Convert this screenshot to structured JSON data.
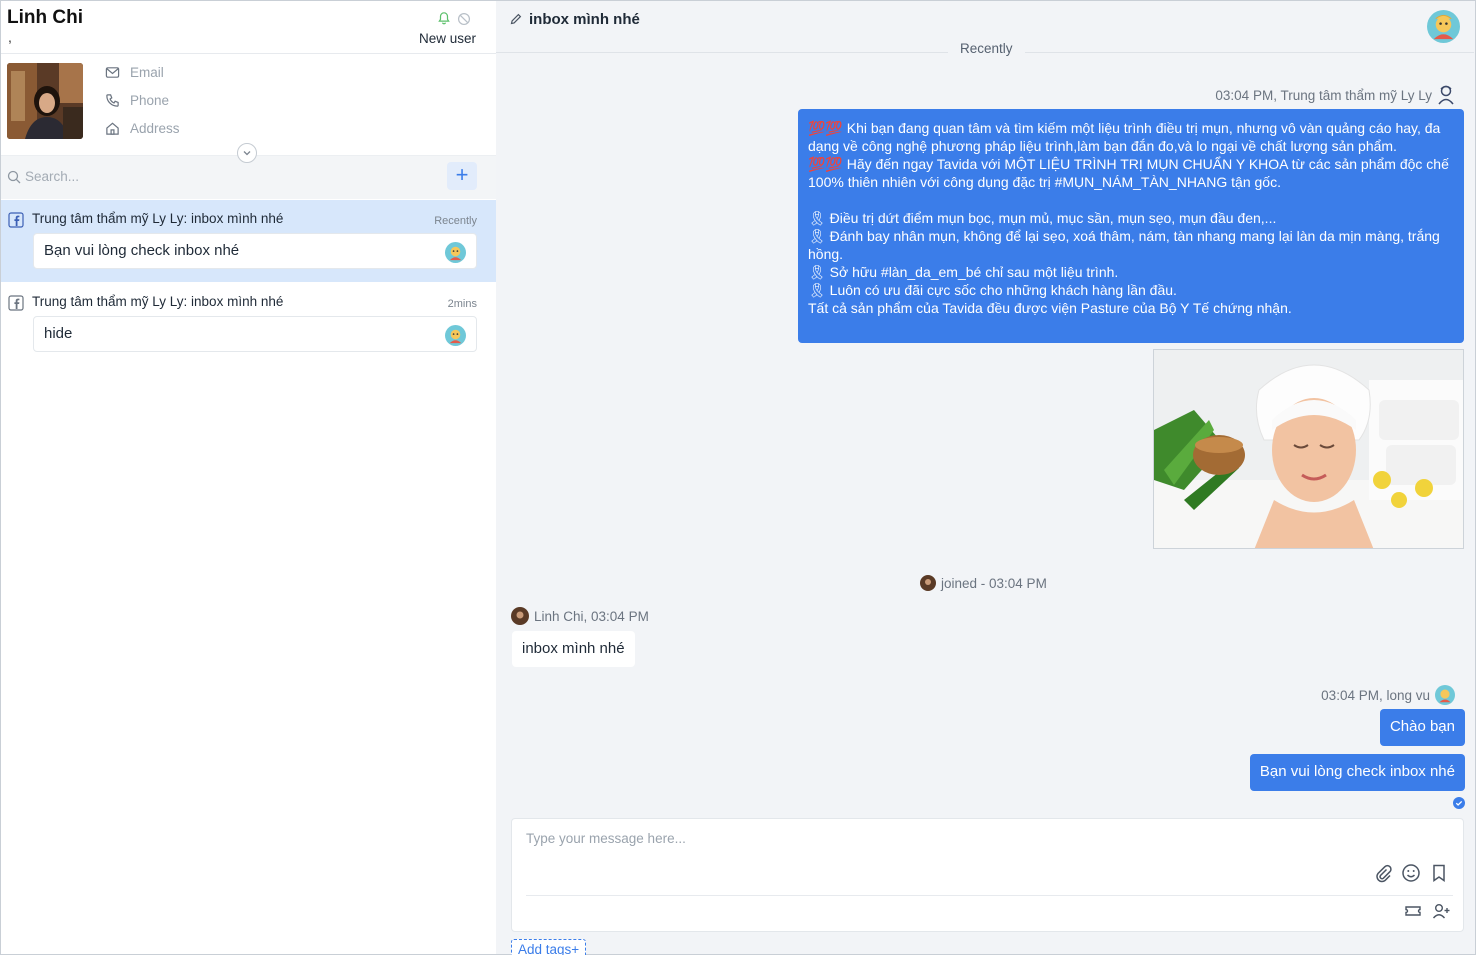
{
  "contact": {
    "name": "Linh Chi",
    "dot": ",",
    "status": "New user",
    "email_label": "Email",
    "phone_label": "Phone",
    "address_label": "Address"
  },
  "search": {
    "placeholder": "Search..."
  },
  "add_button": "+",
  "conversations": [
    {
      "title": "Trung tâm thẩm mỹ Ly Ly: inbox mình nhé",
      "time": "Recently",
      "preview": "Bạn vui lòng check inbox nhé",
      "active": true
    },
    {
      "title": "Trung tâm thẩm mỹ Ly Ly: inbox mình nhé",
      "time": "2mins",
      "preview": "hide",
      "active": false
    }
  ],
  "chat": {
    "title": "inbox mình nhé",
    "divider": "Recently",
    "messages": {
      "page_meta": "03:04 PM, Trung tâm thẩm mỹ Ly Ly",
      "page_text": "💯💯 Khi bạn đang quan tâm và tìm kiếm một liệu trình điều trị mụn, nhưng vô vàn quảng cáo hay, đa dạng về công nghệ phương pháp liệu trình,làm bạn đắn đo,và lo ngại về chất lượng sản phẩm.\n💯💯 Hãy đến ngay Tavida với MỘT LIỆU TRÌNH TRỊ MỤN CHUẨN Y KHOA từ các sản phẩm độc chế 100% thiên nhiên với công dụng đặc trị #MỤN_NÁM_TÀN_NHANG tận gốc.\n\n🎗 Điều trị dứt điểm mụn bọc, mụn mủ, mục sần, mụn sẹo, mụn đầu đen,...\n🎗 Đánh bay nhân mụn, không để lại sẹo, xoá thâm, nám, tàn nhang mang lại làn da mịn màng, trắng hồng.\n🎗 Sở hữu #làn_da_em_bé chỉ sau một liệu trình.\n🎗 Luôn có ưu đãi cực sốc cho những khách hàng lần đầu.\nTất cả sản phẩm của Tavida đều được viện Pasture của Bộ Y Tế chứng nhận.",
      "joined": "joined - 03:04 PM",
      "customer_meta": "Linh Chi, 03:04 PM",
      "customer_text": "inbox mình nhé",
      "agent_meta": "03:04 PM, long vu",
      "agent_text_1": "Chào bạn",
      "agent_text_2": "Bạn vui lòng check inbox nhé"
    },
    "composer": {
      "placeholder": "Type your message here..."
    },
    "add_tags": "Add tags+"
  },
  "colors": {
    "accent": "#3b7de9",
    "active_row": "#d7e7fb",
    "chat_bg": "#f2f4f7"
  },
  "icons": [
    "bell-icon",
    "block-icon",
    "mail-icon",
    "phone-icon",
    "home-icon",
    "chevron-down-icon",
    "search-icon",
    "facebook-icon",
    "pencil-icon",
    "attach-icon",
    "emoji-icon",
    "bookmark-icon",
    "ticket-icon",
    "add-user-icon",
    "seen-check-icon"
  ]
}
